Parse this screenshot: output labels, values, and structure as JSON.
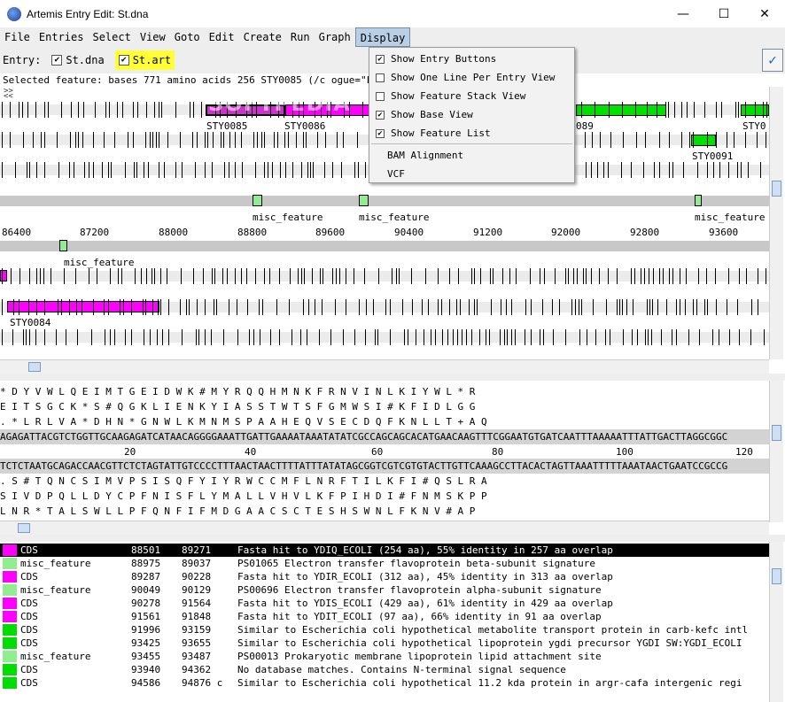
{
  "window": {
    "title": "Artemis Entry Edit: St.dna",
    "minimize": "—",
    "maximize": "☐",
    "close": "✕"
  },
  "menu": [
    "File",
    "Entries",
    "Select",
    "View",
    "Goto",
    "Edit",
    "Create",
    "Run",
    "Graph",
    "Display"
  ],
  "entry_bar": {
    "label": "Entry:",
    "entries": [
      {
        "name": "St.dna",
        "checked": true
      },
      {
        "name": "St.art",
        "checked": true
      }
    ]
  },
  "selected_feature": "Selected feature:  bases 771  amino acids 256  STY0085  (/c                              ogue=\"FIXA_ECOLI\" /ec_paralogue=\"Y",
  "display_menu": {
    "items": [
      {
        "label": "Show Entry Buttons",
        "checked": true
      },
      {
        "label": "Show One Line Per Entry View",
        "checked": false
      },
      {
        "label": "Show Feature Stack View",
        "checked": false
      },
      {
        "label": "Show Base View",
        "checked": true
      },
      {
        "label": "Show Feature List",
        "checked": true
      }
    ],
    "extra": [
      "BAM Alignment",
      "VCF"
    ]
  },
  "overview": {
    "features": [
      "STY0085",
      "STY0086",
      "089",
      "STY0",
      "STY0091",
      "misc_feature",
      "misc_feature",
      "misc_feature",
      "misc_feature",
      "STY0084"
    ],
    "ruler": [
      "86400",
      "87200",
      "88000",
      "88800",
      "89600",
      "90400",
      "91200",
      "92000",
      "92800",
      "93600"
    ]
  },
  "watermark": "SOFTPEDIA",
  "base_view": {
    "frames_top": [
      "* D Y V W L Q E I M T G E I D W K # M Y R Q Q H M N K F R N V I N L K I Y W L * R",
      "  E I T S G C K * S # Q G K L I E N K Y I A S S T W T S F G M W S I # K F I D L G G",
      ". * L R L V A * D H N * G N W L K M N M S P A A H E Q V S E C D Q F K N L L T + A Q"
    ],
    "dna_forward": "AGAGATTACGTCTGGTTGCAAGAGATCATAACAGGGGAAATTGATTGAAAATAAATATATCGCCAGCAGCACATGAACAAGTTTCGGAATGTGATCAATTTAAAAATTTATTGACTTAGGCGGC",
    "ruler": [
      "20",
      "40",
      "60",
      "80",
      "100",
      "120"
    ],
    "dna_reverse": "TCTCTAATGCAGACCAACGTTCTCTAGTATTGTCCCCTTTAACTAACTTTTATTTATATAGCGGTCGTCGTGTACTTGTTCAAAGCCTTACACTAGTTAAATTTTTAAATAACTGAATCCGCCG",
    "frames_bottom": [
      ". S # T Q N C S I M V P S I S Q F Y I Y R W C C M F L N R F T I L K F I # Q S L R A",
      "  S I V D P Q L L D Y C P F N I S F L Y M A L L V H V L K F P I H D I # F N M S K P P",
      "  L N R * T A L S W L L P F Q N F I F M D G A A C S C T E S H S W N L F K N V # A P"
    ]
  },
  "feature_list": [
    {
      "key": "CDS",
      "start": "88501",
      "end": "89271",
      "note": "Fasta hit to YDIQ_ECOLI (254 aa), 55% identity in 257 aa overlap",
      "color": "#ff00ff",
      "selected": true
    },
    {
      "key": "misc_feature",
      "start": "88975",
      "end": "89037",
      "note": "PS01065 Electron transfer flavoprotein beta-subunit signature",
      "color": "#90ee90",
      "selected": false
    },
    {
      "key": "CDS",
      "start": "89287",
      "end": "90228",
      "note": "Fasta hit to YDIR_ECOLI (312 aa), 45% identity in 313 aa overlap",
      "color": "#ff00ff",
      "selected": false
    },
    {
      "key": "misc_feature",
      "start": "90049",
      "end": "90129",
      "note": "PS00696 Electron transfer flavoprotein alpha-subunit signature",
      "color": "#90ee90",
      "selected": false
    },
    {
      "key": "CDS",
      "start": "90278",
      "end": "91564",
      "note": "Fasta hit to YDIS_ECOLI (429 aa), 61% identity in 429 aa overlap",
      "color": "#ff00ff",
      "selected": false
    },
    {
      "key": "CDS",
      "start": "91561",
      "end": "91848",
      "note": "Fasta hit to YDIT_ECOLI (97 aa), 66% identity in 91 aa overlap",
      "color": "#ff00ff",
      "selected": false
    },
    {
      "key": "CDS",
      "start": "91996",
      "end": "93159",
      "note": "Similar to Escherichia coli hypothetical metabolite transport protein in carb-kefc intl",
      "color": "#00dd00",
      "selected": false
    },
    {
      "key": "CDS",
      "start": "93425",
      "end": "93655",
      "note": "Similar to Escherichia coli hypothetical lipoprotein ygdi precursor YGDI SW:YGDI_ECOLI",
      "color": "#00dd00",
      "selected": false
    },
    {
      "key": "misc_feature",
      "start": "93455",
      "end": "93487",
      "note": "PS00013 Prokaryotic membrane lipoprotein lipid attachment site",
      "color": "#90ee90",
      "selected": false
    },
    {
      "key": "CDS",
      "start": "93940",
      "end": "94362",
      "note": "No database matches. Contains N-terminal signal sequence",
      "color": "#00dd00",
      "selected": false
    },
    {
      "key": "CDS",
      "start": "94586",
      "end": "94876 c",
      "note": "Similar to Escherichia coli hypothetical 11.2 kda protein in argr-cafa intergenic regi",
      "color": "#00dd00",
      "selected": false
    }
  ]
}
